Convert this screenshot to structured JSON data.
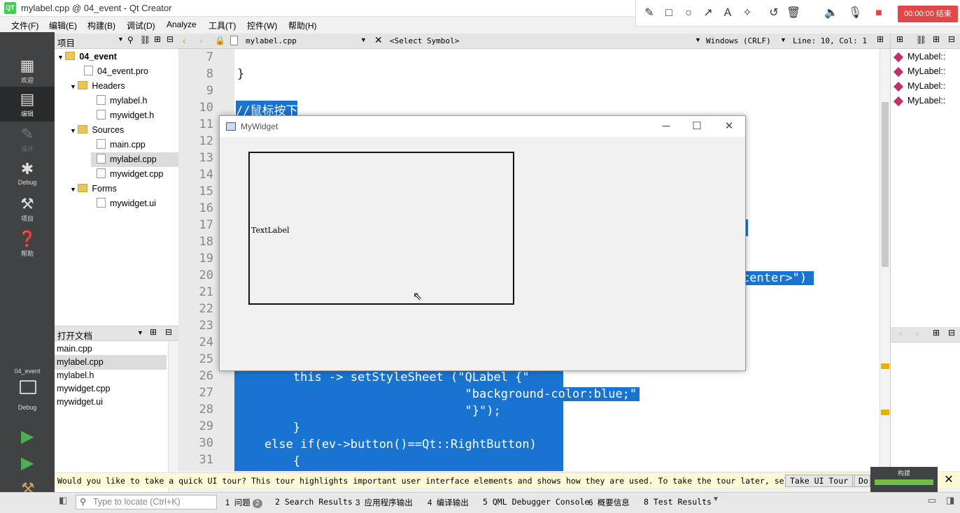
{
  "window": {
    "title": "mylabel.cpp @ 04_event - Qt Creator",
    "qt_logo": "QT"
  },
  "recorder": {
    "tools": [
      "pencil-icon",
      "rect-icon",
      "circle-icon",
      "arrow-icon",
      "text-icon",
      "magic-icon",
      "undo-icon",
      "trash-icon",
      "speaker-icon",
      "mic-icon",
      "stop-icon"
    ],
    "timer": "00:00:00 结束"
  },
  "menu": [
    "文件(F)",
    "编辑(E)",
    "构建(B)",
    "调试(D)",
    "Analyze",
    "工具(T)",
    "控件(W)",
    "帮助(H)"
  ],
  "modes": [
    {
      "label": "欢迎",
      "icon": "grid-icon"
    },
    {
      "label": "编辑",
      "icon": "edit-doc-icon"
    },
    {
      "label": "设计",
      "icon": "pencil-icon"
    },
    {
      "label": "Debug",
      "icon": "bug-icon"
    },
    {
      "label": "项目",
      "icon": "wrench-icon"
    },
    {
      "label": "帮助",
      "icon": "help-icon"
    }
  ],
  "kit": {
    "project": "04_event",
    "mode": "Debug"
  },
  "project_panel": {
    "title": "项目"
  },
  "tree": [
    {
      "label": "04_event"
    },
    {
      "label": "04_event.pro"
    },
    {
      "label": "Headers"
    },
    {
      "label": "mylabel.h"
    },
    {
      "label": "mywidget.h"
    },
    {
      "label": "Sources"
    },
    {
      "label": "main.cpp"
    },
    {
      "label": "mylabel.cpp"
    },
    {
      "label": "mywidget.cpp"
    },
    {
      "label": "Forms"
    },
    {
      "label": "mywidget.ui"
    }
  ],
  "open_docs": {
    "title": "打开文档",
    "items": [
      "main.cpp",
      "mylabel.cpp",
      "mylabel.h",
      "mywidget.cpp",
      "mywidget.ui"
    ]
  },
  "editor": {
    "file": "mylabel.cpp",
    "symbol": "<Select Symbol>",
    "line_ending": "Windows (CRLF)",
    "position": "Line: 10, Col: 1",
    "line_numbers": [
      "7",
      "8",
      "9",
      "10",
      "11",
      "12",
      "13",
      "14",
      "15",
      "16",
      "17",
      "18",
      "19",
      "20",
      "21",
      "22",
      "23",
      "24",
      "25",
      "26",
      "27",
      "28",
      "29",
      "30",
      "31"
    ],
    "code": [
      {
        "t": "}"
      },
      {
        "t": "//鼠标按下"
      },
      {
        "t": "center>\")"
      },
      {
        "t": "        this -> setStyleSheet (\"QLabel {\""
      },
      {
        "t": "                                \"background-color:blue;\""
      },
      {
        "t": "                                \"}\");"
      },
      {
        "t": "        }"
      },
      {
        "t": "    else if(ev->button()==Qt::RightButton)"
      },
      {
        "t": "        {"
      }
    ]
  },
  "outline": [
    "MyLabel::",
    "MyLabel::",
    "MyLabel::",
    "MyLabel::"
  ],
  "mywidget": {
    "title": "MyWidget",
    "label_text": "TextLabel"
  },
  "notification": {
    "message": "Would you like to take a quick UI tour? This tour highlights important user interface elements and shows how they are used. To take the tour later, select Help > UI Tour.",
    "tour_button": "Take UI Tour",
    "dismiss_button": "Do"
  },
  "build": {
    "label": "构建"
  },
  "status": {
    "locator_placeholder": "Type to locate (Ctrl+K)",
    "tabs": [
      {
        "num": "1",
        "label": "问题",
        "badge": "2"
      },
      {
        "num": "2",
        "label": "Search Results"
      },
      {
        "num": "3",
        "label": "应用程序输出"
      },
      {
        "num": "4",
        "label": "编译输出"
      },
      {
        "num": "5",
        "label": "QML Debugger Console"
      },
      {
        "num": "6",
        "label": "概要信息"
      },
      {
        "num": "8",
        "label": "Test Results"
      }
    ]
  }
}
